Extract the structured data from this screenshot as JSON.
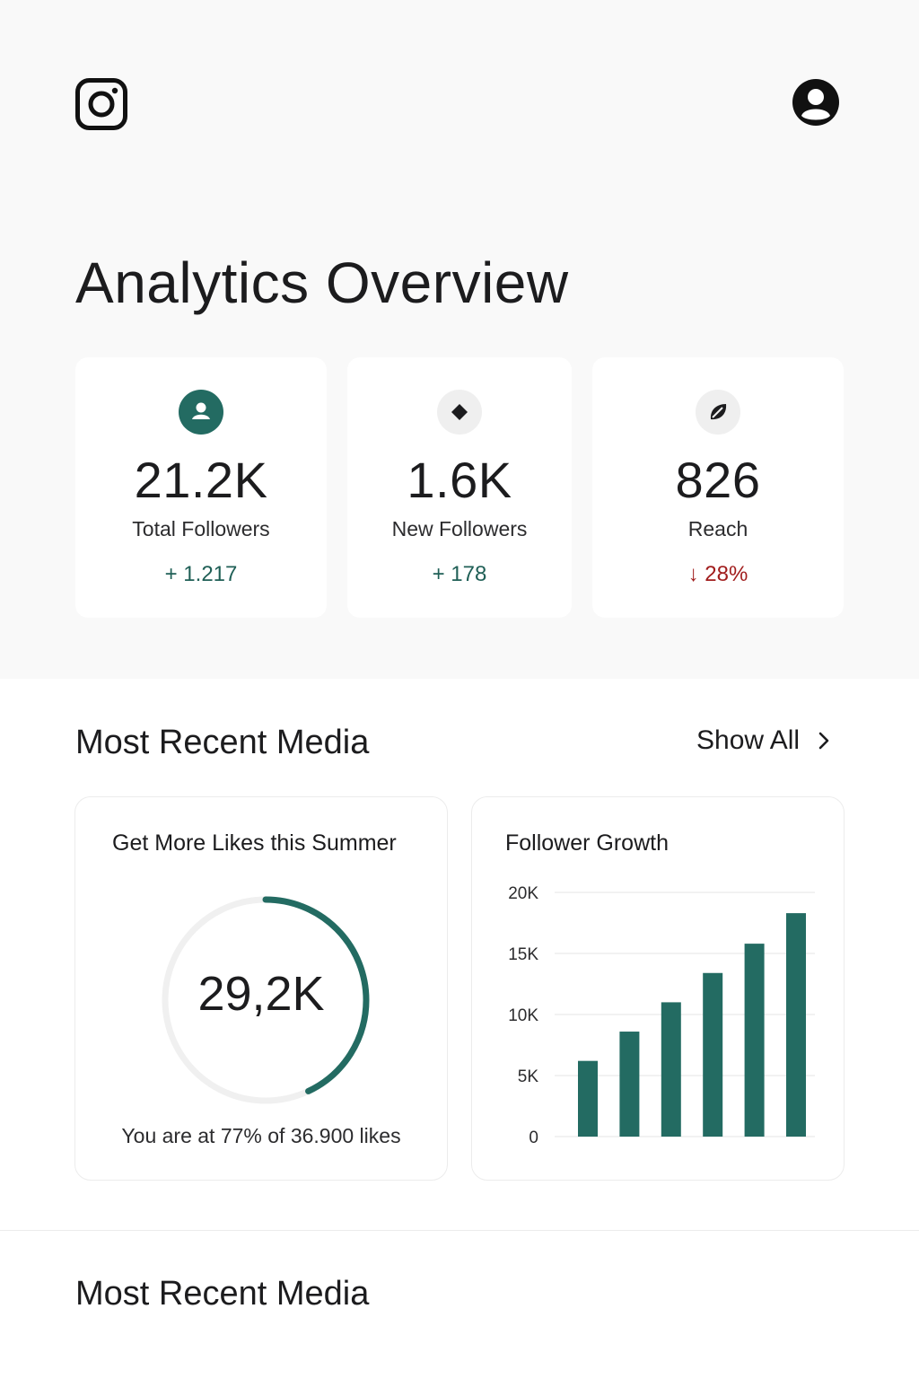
{
  "header": {
    "logo_icon": "instagram-icon",
    "profile_icon": "user-circle-icon"
  },
  "page_title": "Analytics Overview",
  "stats": [
    {
      "icon": "person-icon",
      "value": "21.2K",
      "label": "Total Followers",
      "change": "+ 1.217",
      "trend": "up"
    },
    {
      "icon": "diamond-icon",
      "value": "1.6K",
      "label": "New Followers",
      "change": "+ 178",
      "trend": "up"
    },
    {
      "icon": "leaf-icon",
      "value": "826",
      "label": "Reach",
      "change": "↓ 28%",
      "trend": "down"
    }
  ],
  "recent_media": {
    "title": "Most Recent Media",
    "show_all_label": "Show All"
  },
  "likes_card": {
    "title": "Get More Likes this Summer",
    "value": "29,2K",
    "progress": 0.77,
    "caption": "You are at 77% of 36.900 likes"
  },
  "growth_card": {
    "title": "Follower Growth"
  },
  "chart_data": {
    "type": "bar",
    "title": "Follower Growth",
    "categories": [
      "",
      "",
      "",
      "",
      "",
      ""
    ],
    "values": [
      6200,
      8600,
      11000,
      13400,
      15800,
      18300
    ],
    "yticks": [
      "0",
      "5K",
      "10K",
      "15K",
      "20K"
    ],
    "ylim": [
      0,
      20000
    ],
    "grid": true,
    "xlabel": "",
    "ylabel": ""
  },
  "second_section_title": "Most Recent Media",
  "colors": {
    "accent": "#236b62",
    "up": "#1f5f56",
    "down": "#a11d1d",
    "background": "#f9f9f9"
  }
}
